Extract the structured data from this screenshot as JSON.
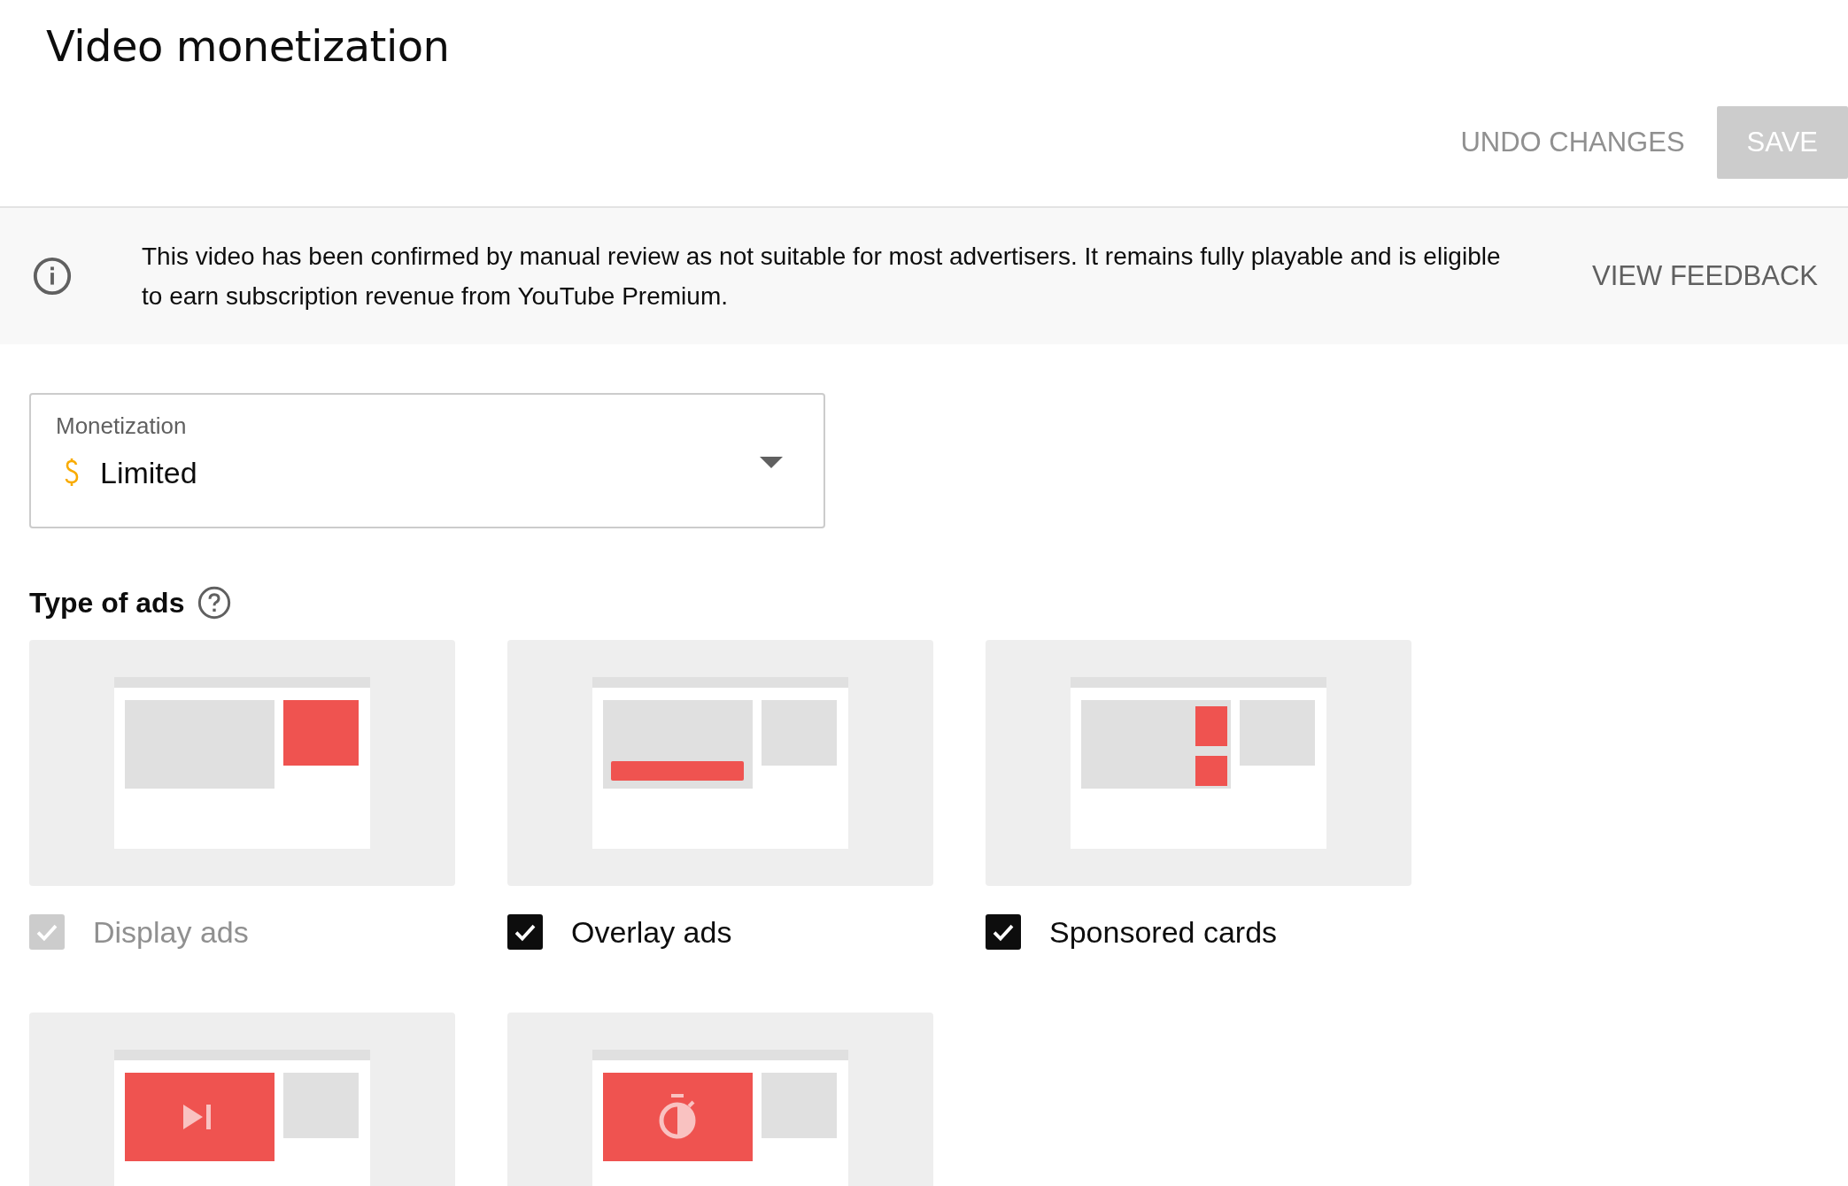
{
  "page_title": "Video monetization",
  "undo_button": {
    "label": "UNDO CHANGES",
    "disabled": true
  },
  "save_button": {
    "label": "SAVE",
    "disabled": true
  },
  "banner": {
    "message": "This video has been confirmed by manual review as not suitable for most advertisers. It remains fully playable and is eligible to earn subscription revenue from YouTube Premium.",
    "action": "VIEW FEEDBACK"
  },
  "monetization": {
    "label": "Monetization",
    "value": "Limited"
  },
  "ads_section": {
    "title": "Type of ads",
    "ad_types": [
      {
        "kind": "display",
        "label": "Display ads",
        "checked": true,
        "disabled": true
      },
      {
        "kind": "overlay",
        "label": "Overlay ads",
        "checked": true,
        "disabled": false
      },
      {
        "kind": "sponsored",
        "label": "Sponsored cards",
        "checked": true,
        "disabled": false
      },
      {
        "kind": "skippable"
      },
      {
        "kind": "nonskippable"
      }
    ]
  }
}
